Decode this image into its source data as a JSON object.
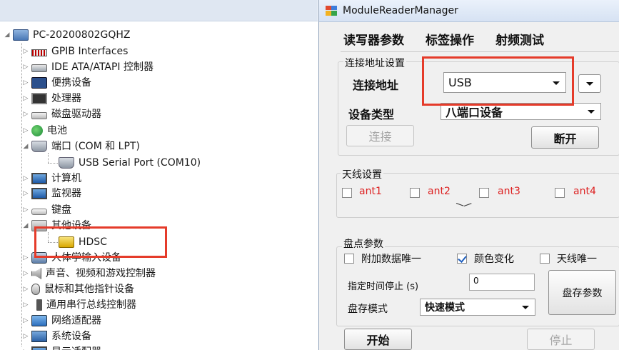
{
  "device_manager": {
    "root": "PC-20200802GQHZ",
    "items": [
      {
        "label": "GPIB Interfaces",
        "icon": "gpib-interface-icon"
      },
      {
        "label": "IDE ATA/ATAPI 控制器",
        "icon": "ide-controller-icon"
      },
      {
        "label": "便携设备",
        "icon": "portable-device-icon"
      },
      {
        "label": "处理器",
        "icon": "processor-icon"
      },
      {
        "label": "磁盘驱动器",
        "icon": "disk-drive-icon"
      },
      {
        "label": "电池",
        "icon": "battery-icon"
      },
      {
        "label": "端口 (COM 和 LPT)",
        "icon": "port-icon"
      },
      {
        "label": "USB Serial Port (COM10)",
        "icon": "serial-port-icon"
      },
      {
        "label": "计算机",
        "icon": "computer-icon"
      },
      {
        "label": "监视器",
        "icon": "monitor-icon"
      },
      {
        "label": "键盘",
        "icon": "keyboard-icon"
      },
      {
        "label": "其他设备",
        "icon": "other-devices-icon"
      },
      {
        "label": "HDSC",
        "icon": "warning-device-icon"
      },
      {
        "label": "人体学输入设备",
        "icon": "hid-icon"
      },
      {
        "label": "声音、视频和游戏控制器",
        "icon": "speaker-icon"
      },
      {
        "label": "鼠标和其他指针设备",
        "icon": "mouse-icon"
      },
      {
        "label": "通用串行总线控制器",
        "icon": "usb-icon"
      },
      {
        "label": "网络适配器",
        "icon": "network-adapter-icon"
      },
      {
        "label": "系统设备",
        "icon": "system-device-icon"
      },
      {
        "label": "显示适配器",
        "icon": "display-adapter-icon"
      }
    ]
  },
  "app": {
    "title": "ModuleReaderManager",
    "menu": [
      "读写器参数",
      "标签操作",
      "射频测试"
    ],
    "connection": {
      "group_title": "连接地址设置",
      "address_label": "连接地址",
      "address_value": "USB",
      "device_type_label": "设备类型",
      "device_type_value": "八端口设备",
      "connect_button": "连接",
      "disconnect_button": "断开"
    },
    "antenna": {
      "group_title": "天线设置",
      "ports": [
        "ant1",
        "ant2",
        "ant3",
        "ant4"
      ]
    },
    "inventory": {
      "group_title": "盘点参数",
      "options": [
        {
          "label": "附加数据唯一",
          "checked": false
        },
        {
          "label": "颜色变化",
          "checked": true
        },
        {
          "label": "天线唯一",
          "checked": false
        }
      ],
      "stop_time_label": "指定时间停止 (s)",
      "stop_time_value": "0",
      "save_mode_label": "盘存模式",
      "save_mode_value": "快速模式",
      "inventory_params_button": "盘存参数",
      "start_button": "开始",
      "stop_button": "停止"
    }
  },
  "colors": {
    "highlight_box": "#e53b2a",
    "antenna_label": "#d22222"
  }
}
